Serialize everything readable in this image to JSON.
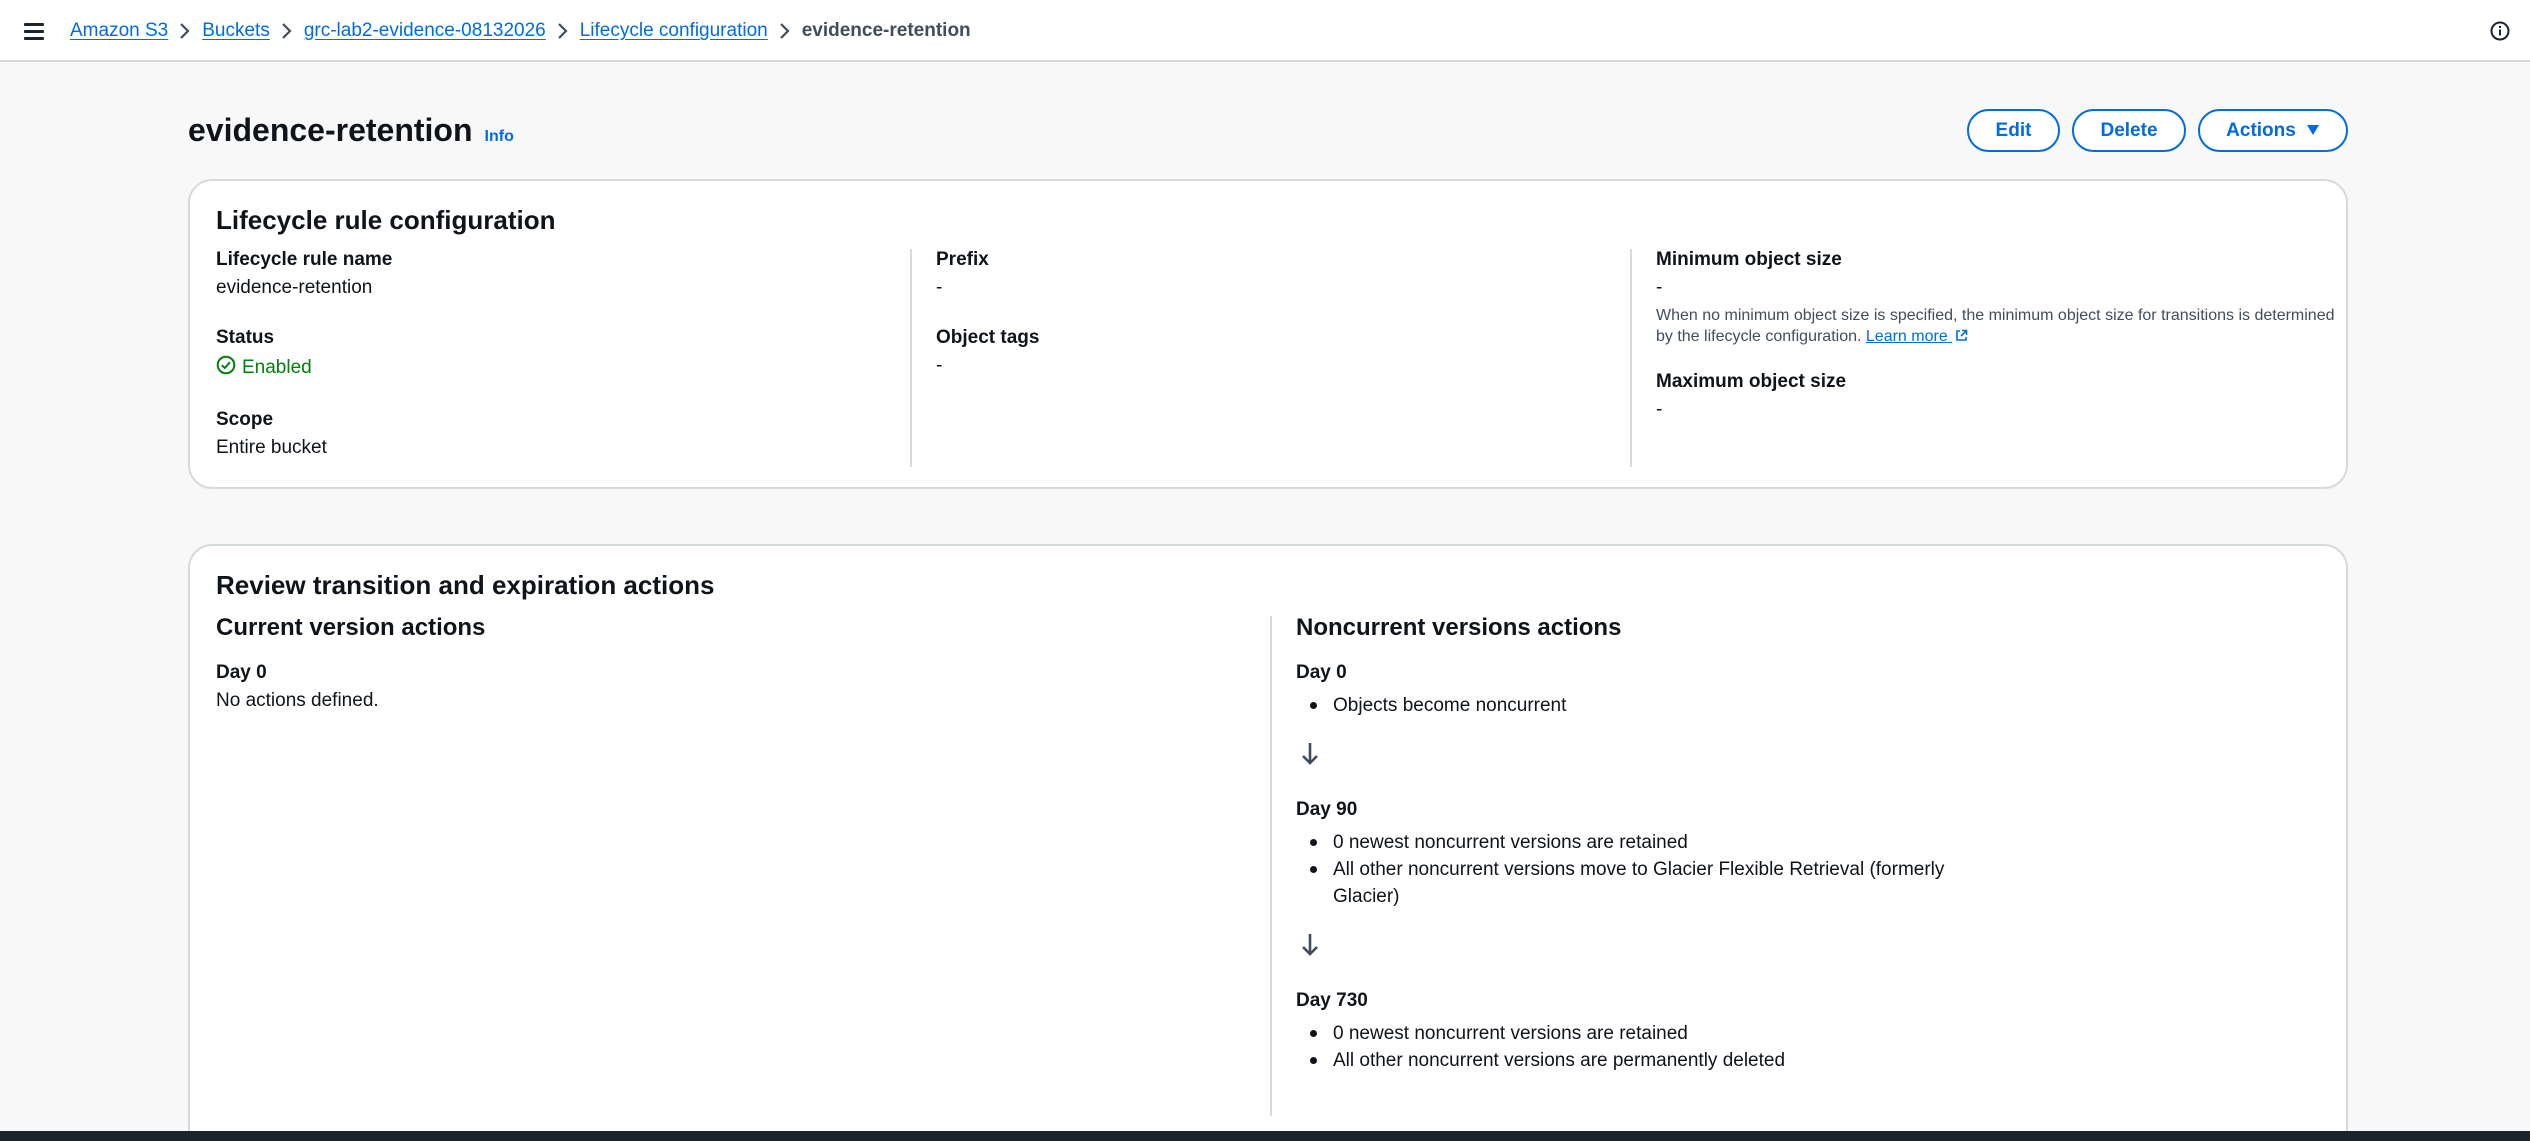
{
  "breadcrumb": {
    "items": [
      "Amazon S3",
      "Buckets",
      "grc-lab2-evidence-08132026",
      "Lifecycle configuration"
    ],
    "current": "evidence-retention"
  },
  "header": {
    "title": "evidence-retention",
    "info_label": "Info",
    "edit_label": "Edit",
    "delete_label": "Delete",
    "actions_label": "Actions"
  },
  "rule_config": {
    "title": "Lifecycle rule configuration",
    "name_label": "Lifecycle rule name",
    "name_value": "evidence-retention",
    "status_label": "Status",
    "status_value": "Enabled",
    "scope_label": "Scope",
    "scope_value": "Entire bucket",
    "prefix_label": "Prefix",
    "prefix_value": "-",
    "tags_label": "Object tags",
    "tags_value": "-",
    "min_size_label": "Minimum object size",
    "min_size_value": "-",
    "min_size_note": "When no minimum object size is specified, the minimum object size for transitions is determined by the lifecycle configuration.",
    "learn_more": "Learn more",
    "max_size_label": "Maximum object size",
    "max_size_value": "-"
  },
  "review": {
    "title": "Review transition and expiration actions",
    "current": {
      "title": "Current version actions",
      "day_label": "Day 0",
      "text": "No actions defined."
    },
    "noncurrent": {
      "title": "Noncurrent versions actions",
      "steps": [
        {
          "day": "Day 0",
          "items": [
            "Objects become noncurrent"
          ]
        },
        {
          "day": "Day 90",
          "items": [
            "0 newest noncurrent versions are retained",
            "All other noncurrent versions move to Glacier Flexible Retrieval (formerly",
            "Glacier)"
          ]
        },
        {
          "day": "Day 730",
          "items": [
            "0 newest noncurrent versions are retained",
            "All other noncurrent versions are permanently deleted"
          ]
        }
      ]
    }
  },
  "colors": {
    "link": "#006ce0",
    "success": "#037f0c",
    "border": "#d5dbdb"
  },
  "icons": [
    "hamburger-icon",
    "chevron-right-icon",
    "info-circle-icon",
    "caret-down-icon",
    "check-circle-icon",
    "external-link-icon",
    "arrow-down-icon"
  ]
}
